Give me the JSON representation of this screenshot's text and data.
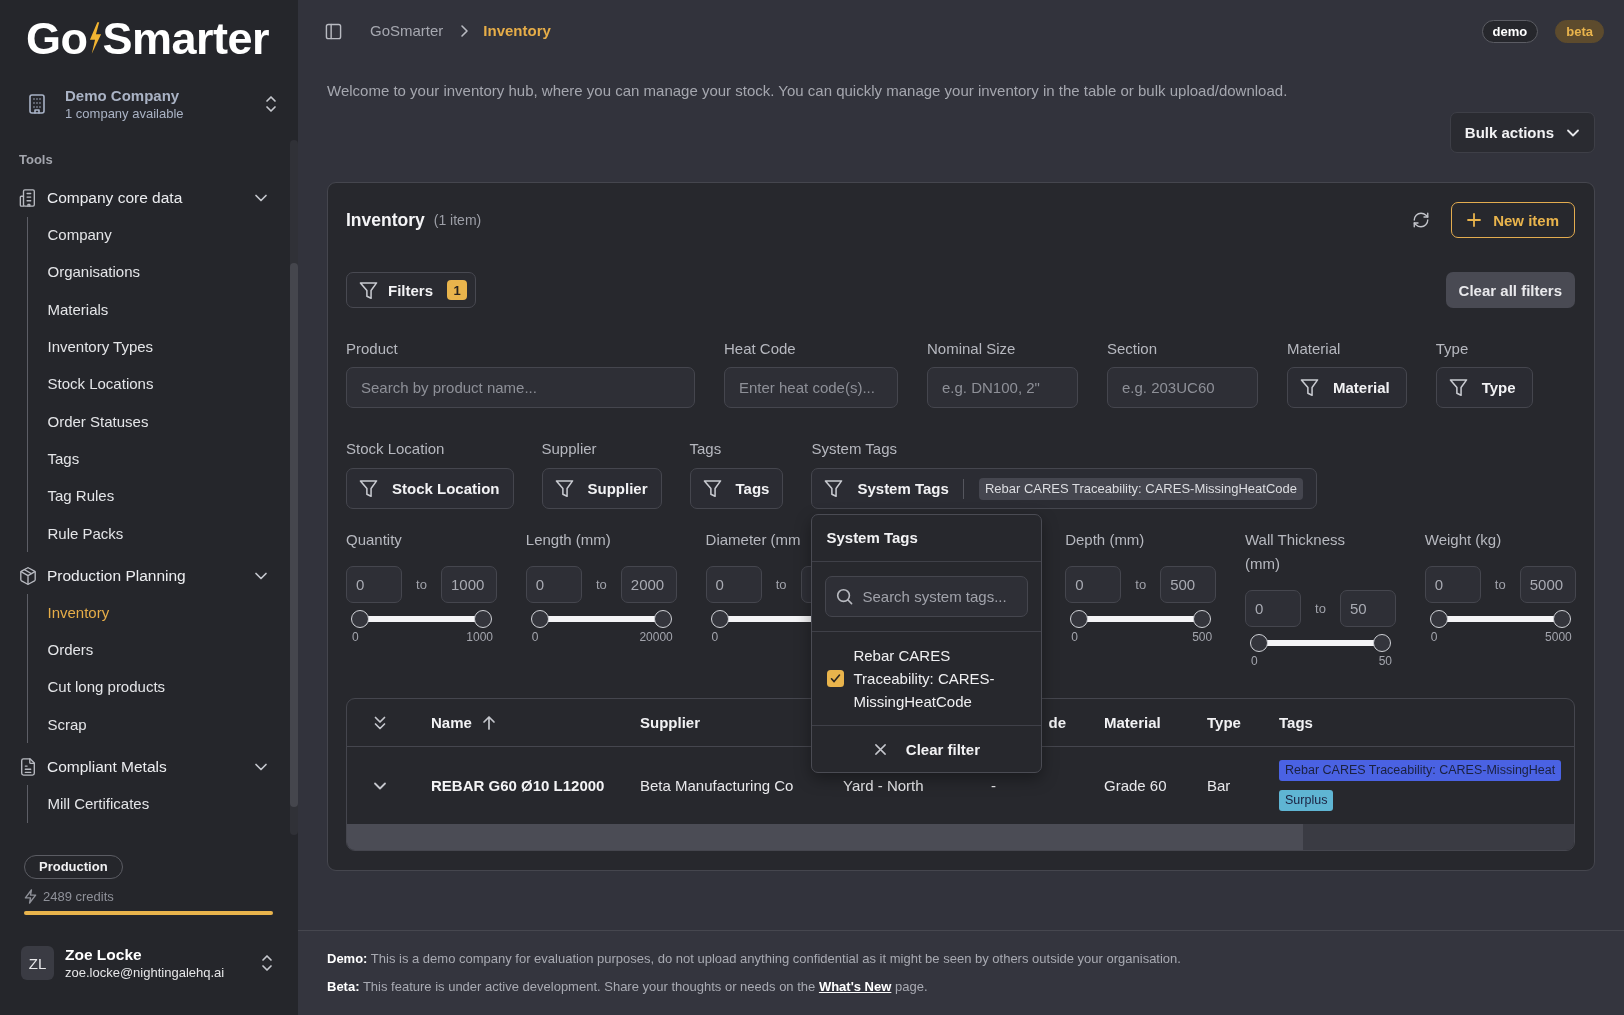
{
  "sidebar": {
    "logo": {
      "first": "Go",
      "second": "Smarter"
    },
    "company": {
      "name": "Demo Company",
      "subtitle": "1 company available"
    },
    "section": "Tools",
    "groups": [
      {
        "label": "Company core data",
        "expanded": true,
        "children": [
          {
            "label": "Company",
            "selected": false
          },
          {
            "label": "Organisations",
            "selected": false
          },
          {
            "label": "Materials",
            "selected": false
          },
          {
            "label": "Inventory Types",
            "selected": false
          },
          {
            "label": "Stock Locations",
            "selected": false
          },
          {
            "label": "Order Statuses",
            "selected": false
          },
          {
            "label": "Tags",
            "selected": false
          },
          {
            "label": "Tag Rules",
            "selected": false
          },
          {
            "label": "Rule Packs",
            "selected": false
          }
        ]
      },
      {
        "label": "Production Planning",
        "expanded": true,
        "children": [
          {
            "label": "Inventory",
            "selected": true
          },
          {
            "label": "Orders",
            "selected": false
          },
          {
            "label": "Cut long products",
            "selected": false
          },
          {
            "label": "Scrap",
            "selected": false
          }
        ]
      },
      {
        "label": "Compliant Metals",
        "expanded": true,
        "children": [
          {
            "label": "Mill Certificates",
            "selected": false
          }
        ]
      }
    ],
    "environment": "Production",
    "credits": {
      "text": "2489 credits",
      "level": 1
    },
    "user": {
      "initials": "ZL",
      "name": "Zoe Locke",
      "email": "zoe.locke@nightingalehq.ai"
    }
  },
  "header": {
    "breadcrumbs": [
      {
        "label": "GoSmarter",
        "selected": false
      },
      {
        "label": "Inventory",
        "selected": true
      }
    ],
    "badges": [
      {
        "label": "demo",
        "kind": "demo"
      },
      {
        "label": "beta",
        "kind": "beta"
      }
    ]
  },
  "intro": "Welcome to your inventory hub, where you can manage your stock. You can quickly manage your inventory in the table or bulk upload/download.",
  "bulk_actions": "Bulk actions",
  "inventory": {
    "title": "Inventory",
    "count": "(1 item)",
    "new_item": "New item",
    "filters_button": {
      "label": "Filters",
      "count": "1"
    },
    "clear_all": "Clear all filters",
    "filter_rows": [
      [
        {
          "kind": "text",
          "label": "Product",
          "placeholder": "Search by product name..."
        },
        {
          "kind": "text",
          "label": "Heat Code",
          "placeholder": "Enter heat code(s)..."
        },
        {
          "kind": "text",
          "label": "Nominal Size",
          "placeholder": "e.g. DN100, 2\""
        },
        {
          "kind": "text",
          "label": "Section",
          "placeholder": "e.g. 203UC60"
        },
        {
          "kind": "select",
          "label": "Material",
          "button": "Material"
        },
        {
          "kind": "select",
          "label": "Type",
          "button": "Type"
        }
      ],
      [
        {
          "kind": "select",
          "label": "Stock Location",
          "button": "Stock Location"
        },
        {
          "kind": "select",
          "label": "Supplier",
          "button": "Supplier"
        },
        {
          "kind": "select",
          "label": "Tags",
          "button": "Tags"
        },
        {
          "kind": "select",
          "label": "System Tags",
          "button": "System Tags",
          "chips": [
            "Rebar CARES Traceability: CARES-MissingHeatCode"
          ],
          "open": true,
          "dropdown": {
            "title": "System Tags",
            "search_placeholder": "Search system tags...",
            "options": [
              {
                "label": "Rebar CARES Traceability: CARES-MissingHeatCode",
                "checked": true
              }
            ],
            "clear": "Clear filter"
          }
        }
      ]
    ],
    "ranges": [
      {
        "kind": "range",
        "label": "Quantity",
        "min": "0",
        "separator": "to",
        "max": "1000",
        "min_tick": "0",
        "max_tick": "1000",
        "level": 1
      },
      {
        "kind": "range",
        "label": "Length (mm)",
        "min": "0",
        "separator": "to",
        "max": "2000",
        "min_tick": "0",
        "max_tick": "20000",
        "level": 1
      },
      {
        "kind": "range",
        "label": "Diameter (mm",
        "min": "0",
        "separator": "to",
        "min_tick": "0",
        "level": 1
      },
      {
        "kind": "covered"
      },
      {
        "kind": "range",
        "label": "Depth (mm)",
        "min": "0",
        "separator": "to",
        "max": "500",
        "min_tick": "0",
        "max_tick": "500",
        "level": 1
      },
      {
        "kind": "range",
        "label": "Wall Thickness (mm)",
        "min": "0",
        "separator": "to",
        "max": "50",
        "min_tick": "0",
        "max_tick": "50",
        "level": 1
      },
      {
        "kind": "range",
        "label": "Weight (kg)",
        "min": "0",
        "separator": "to",
        "max": "5000",
        "min_tick": "0",
        "max_tick": "5000",
        "level": 1
      }
    ],
    "table": {
      "columns": [
        {
          "kind": "text",
          "label": "Name",
          "sorted": true
        },
        {
          "kind": "text",
          "label": "Supplier",
          "sorted": false
        },
        {
          "kind": "covered"
        },
        {
          "kind": "partial",
          "label": "de",
          "sorted": false
        },
        {
          "kind": "text",
          "label": "Material",
          "sorted": false
        },
        {
          "kind": "text",
          "label": "Type",
          "sorted": false
        },
        {
          "kind": "text",
          "label": "Tags",
          "sorted": false
        }
      ],
      "rows": [
        {
          "expanded": false,
          "cells": [
            "REBAR G60 Ø10 L12000",
            "Beta Manufacturing Co",
            "Yard - North",
            "-",
            "Grade 60",
            "Bar"
          ],
          "tags": [
            {
              "label": "Rebar CARES Traceability: CARES-MissingHeat",
              "color": "#4a62e3"
            },
            {
              "label": "Surplus",
              "color": "#5fb5d3"
            }
          ]
        }
      ]
    }
  },
  "footer": {
    "demo": "**Demo:** This is a demo company for evaluation purposes, do not upload anything confidential as it might be seen by others outside your organisation.",
    "beta": {
      "text": "**Beta:** This feature is under active development. Share your thoughts or needs on the",
      "link": "What's New",
      "after": "page."
    }
  }
}
